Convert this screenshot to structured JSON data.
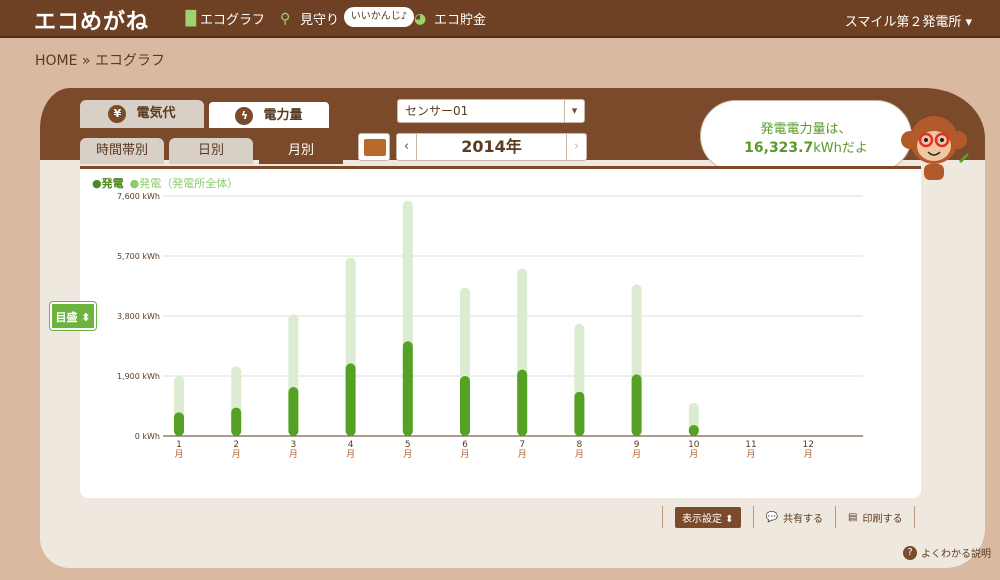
{
  "header": {
    "logo": "エコめがね",
    "nav": [
      {
        "label": "エコグラフ",
        "icon": "bar-chart-icon"
      },
      {
        "label": "見守り",
        "icon": "binoculars-icon"
      },
      {
        "label": "エコ貯金",
        "icon": "piggy-icon"
      }
    ],
    "bubble": "いいかんじ♪",
    "plant_selector": "スマイル第２発電所 ▾"
  },
  "breadcrumb": "HOME » エコグラフ",
  "main_tabs": [
    {
      "label": "電気代",
      "icon": "yen-icon",
      "active": false
    },
    {
      "label": "電力量",
      "icon": "lightning-icon",
      "active": true
    }
  ],
  "period_tabs": [
    {
      "label": "時間帯別",
      "active": false
    },
    {
      "label": "日別",
      "active": false
    },
    {
      "label": "月別",
      "active": true
    }
  ],
  "sensor_select": {
    "value": "センサー01"
  },
  "year_nav": {
    "year": "2014年",
    "prev": "‹",
    "next": "›"
  },
  "speech": {
    "line1": "発電電力量は、",
    "value": "16,323.7",
    "unit": "kWhだよ"
  },
  "legend": {
    "series1": "●発電",
    "series2": "●発電（発電所全体）"
  },
  "meyasu_label": "目盛",
  "chart_data": {
    "type": "bar",
    "categories": [
      "1",
      "2",
      "3",
      "4",
      "5",
      "6",
      "7",
      "8",
      "9",
      "10",
      "11",
      "12"
    ],
    "category_suffix": "月",
    "series": [
      {
        "name": "発電",
        "color": "#55a125",
        "values": [
          750,
          900,
          1550,
          2300,
          3000,
          1900,
          2100,
          1400,
          1950,
          350,
          0,
          0
        ]
      },
      {
        "name": "発電（発電所全体）",
        "color": "#dcecd0",
        "values": [
          1900,
          2200,
          3850,
          5650,
          7450,
          4700,
          5300,
          3550,
          4800,
          1050,
          0,
          0
        ]
      }
    ],
    "ylim": [
      0,
      7600
    ],
    "yticks": [
      "0 kWh",
      "1,900 kWh",
      "3,800 kWh",
      "5,700 kWh",
      "7,600 kWh"
    ],
    "ytick_values": [
      0,
      1900,
      3800,
      5700,
      7600
    ],
    "grid": true
  },
  "footer": {
    "display_settings": "表示設定 ⬍",
    "share": "共有する",
    "print": "印刷する",
    "help": "よくわかる説明"
  }
}
